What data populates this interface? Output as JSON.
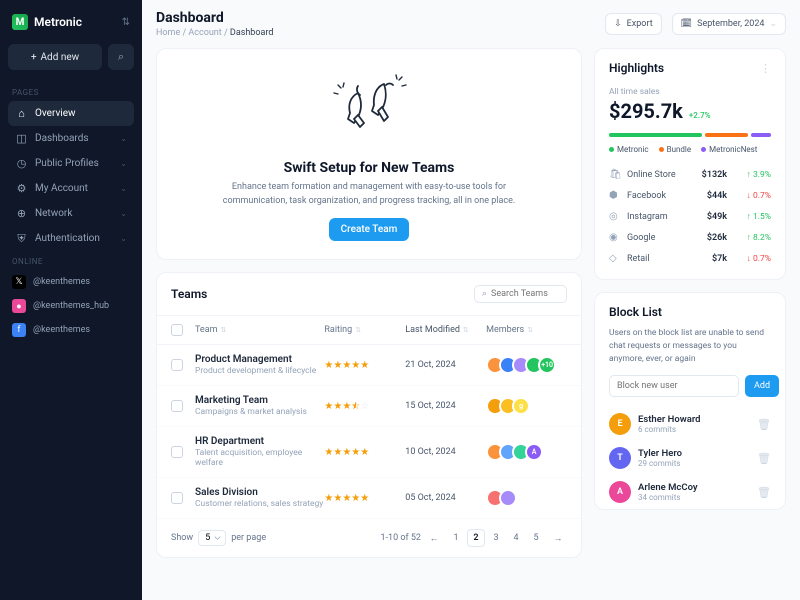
{
  "brand": {
    "name": "Metronic"
  },
  "sidebar": {
    "add_new": "Add new",
    "sec_pages": "PAGES",
    "sec_online": "ONLINE",
    "items": [
      {
        "label": "Overview",
        "icon": "⌂",
        "active": true
      },
      {
        "label": "Dashboards",
        "icon": "◫"
      },
      {
        "label": "Public Profiles",
        "icon": "◷"
      },
      {
        "label": "My Account",
        "icon": "⚙"
      },
      {
        "label": "Network",
        "icon": "⊕"
      },
      {
        "label": "Authentication",
        "icon": "⛨"
      }
    ],
    "online": [
      {
        "label": "@keenthemes",
        "bg": "#000",
        "icon": "𝕏"
      },
      {
        "label": "@keenthemes_hub",
        "bg": "#ec4899",
        "icon": "●"
      },
      {
        "label": "@keenthemes",
        "bg": "#3b82f6",
        "icon": "f"
      }
    ]
  },
  "header": {
    "title": "Dashboard",
    "crumbs": {
      "a": "Home",
      "b": "Account",
      "c": "Dashboard"
    },
    "export": "Export",
    "date": "September, 2024"
  },
  "hero": {
    "title": "Swift Setup for New Teams",
    "desc": "Enhance team formation and management with easy-to-use tools for communication, task organization, and progress tracking, all in one place.",
    "btn": "Create Team"
  },
  "teams": {
    "title": "Teams",
    "search_ph": "Search Teams",
    "cols": {
      "team": "Team",
      "rating": "Raiting",
      "modified": "Last Modified",
      "members": "Members"
    },
    "rows": [
      {
        "name": "Product Management",
        "desc": "Product development & lifecycle",
        "stars": 5,
        "half": false,
        "date": "21 Oct, 2024",
        "avs": [
          "#fb923c",
          "#3b82f6",
          "#a78bfa",
          "#22c55e"
        ],
        "extra": "+10",
        "extra_bg": "#22c55e"
      },
      {
        "name": "Marketing Team",
        "desc": "Campaigns & market analysis",
        "stars": 3,
        "half": true,
        "date": "15 Oct, 2024",
        "avs": [
          "#f59e0b",
          "#fbbf24"
        ],
        "extra": "g",
        "extra_bg": "#fde047"
      },
      {
        "name": "HR Department",
        "desc": "Talent acquisition, employee welfare",
        "stars": 5,
        "half": false,
        "date": "10 Oct, 2024",
        "avs": [
          "#fb923c",
          "#60a5fa",
          "#34d399"
        ],
        "extra": "A",
        "extra_bg": "#8b5cf6"
      },
      {
        "name": "Sales Division",
        "desc": "Customer relations, sales strategy",
        "stars": 5,
        "half": false,
        "date": "05 Oct, 2024",
        "avs": [
          "#f87171",
          "#a78bfa"
        ]
      }
    ],
    "pager": {
      "show": "Show",
      "per_page": "per page",
      "info": "1-10 of 52",
      "pp": "5",
      "pages": [
        "1",
        "2",
        "3",
        "4",
        "5"
      ],
      "active": "2"
    }
  },
  "highlights": {
    "title": "Highlights",
    "sub": "All time sales",
    "amount": "$295.7k",
    "delta": "+2.7%",
    "bars": [
      {
        "w": 55,
        "c": "#22c55e"
      },
      {
        "w": 25,
        "c": "#f97316"
      },
      {
        "w": 12,
        "c": "#8b5cf6"
      }
    ],
    "legend": [
      {
        "c": "#22c55e",
        "t": "Metronic"
      },
      {
        "c": "#f97316",
        "t": "Bundle"
      },
      {
        "c": "#8b5cf6",
        "t": "MetronicNest"
      }
    ],
    "channels": [
      {
        "icon": "🛍",
        "name": "Online Store",
        "val": "$132k",
        "pct": "3.9%",
        "dir": "up"
      },
      {
        "icon": "⬢",
        "name": "Facebook",
        "val": "$44k",
        "pct": "0.7%",
        "dir": "down"
      },
      {
        "icon": "◎",
        "name": "Instagram",
        "val": "$49k",
        "pct": "1.5%",
        "dir": "up"
      },
      {
        "icon": "◉",
        "name": "Google",
        "val": "$26k",
        "pct": "8.2%",
        "dir": "up"
      },
      {
        "icon": "◇",
        "name": "Retail",
        "val": "$7k",
        "pct": "0.7%",
        "dir": "down"
      }
    ]
  },
  "blocklist": {
    "title": "Block List",
    "desc": "Users on the block list are unable to send chat requests or messages to you anymore, ever, or again",
    "input_ph": "Block new user",
    "add": "Add",
    "users": [
      {
        "name": "Esther Howard",
        "commits": "6 commits",
        "c": "#f59e0b"
      },
      {
        "name": "Tyler Hero",
        "commits": "29 commits",
        "c": "#6366f1"
      },
      {
        "name": "Arlene McCoy",
        "commits": "34 commits",
        "c": "#ec4899"
      }
    ]
  }
}
